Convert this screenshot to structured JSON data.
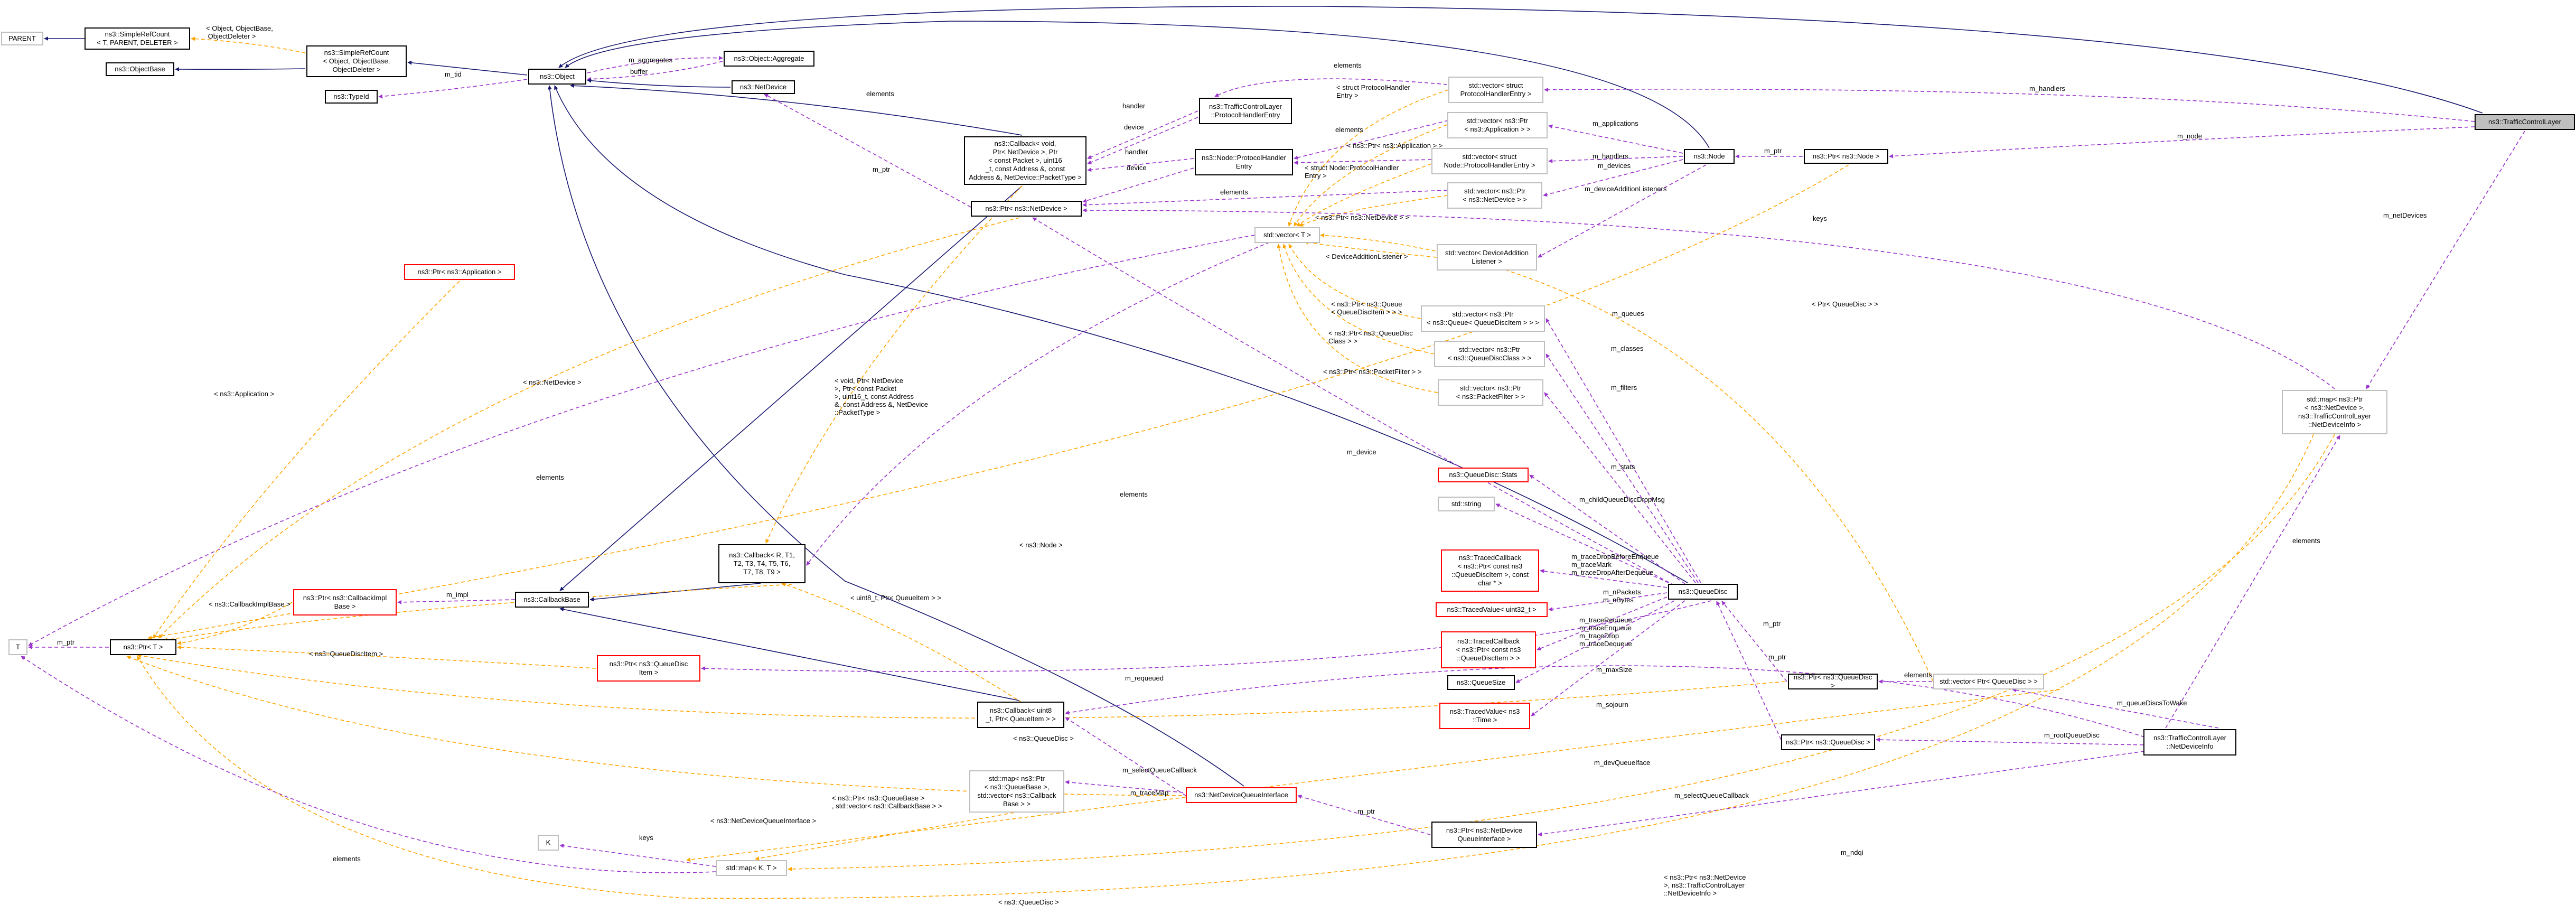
{
  "diagram": {
    "colors": {
      "inherit": "#191970",
      "usage": "#9a32cd",
      "template": "#ffa500",
      "gray_border": "#bfbfbf",
      "red_border": "#ff0000",
      "highlight": "#bfbfbf"
    },
    "nodes": {
      "parent": "PARENT",
      "simple_ref_count_t": "ns3::SimpleRefCount\n< T, PARENT, DELETER >",
      "simple_ref_count_object": "ns3::SimpleRefCount\n< Object, ObjectBase,\n ObjectDeleter >",
      "object_base": "ns3::ObjectBase",
      "object": "ns3::Object",
      "type_id": "ns3::TypeId",
      "aggregate": "ns3::Object::Aggregate",
      "net_device": "ns3::NetDevice",
      "vec_protocol_handler_entry": "std::vector< struct\n ProtocolHandlerEntry >",
      "tcl_protocol_handler_entry": "ns3::TrafficControlLayer\n::ProtocolHandlerEntry",
      "callback_void": "ns3::Callback< void,\n Ptr< NetDevice >, Ptr\n< const Packet >, uint16\n_t, const Address &, const\n Address &, NetDevice::PacketType >",
      "node_protocol_handler_entry": "ns3::Node::ProtocolHandler\nEntry",
      "vec_ptr_application": "std::vector< ns3::Ptr\n< ns3::Application > >",
      "vec_struct_node_phe": "std::vector< struct\n Node::ProtocolHandlerEntry >",
      "vec_ptr_net_device": "std::vector< ns3::Ptr\n< ns3::NetDevice > >",
      "node": "ns3::Node",
      "ptr_node": "ns3::Ptr< ns3::Node >",
      "traffic_control_layer": "ns3::TrafficControlLayer",
      "ptr_net_device": "ns3::Ptr< ns3::NetDevice >",
      "ptr_application": "ns3::Ptr< ns3::Application >",
      "vec_device_addition_listener": "std::vector< DeviceAddition\nListener >",
      "std_vector_t": "std::vector< T >",
      "vec_ptr_queue": "std::vector< ns3::Ptr\n< ns3::Queue< QueueDiscItem > > >",
      "vec_ptr_queue_disc_class": "std::vector< ns3::Ptr\n< ns3::QueueDiscClass > >",
      "vec_ptr_packet_filter": "std::vector< ns3::Ptr\n< ns3::PacketFilter > >",
      "queue_disc_stats": "ns3::QueueDisc::Stats",
      "std_string": "std::string",
      "traced_callback_item": "ns3::TracedCallback\n< ns3::Ptr< const ns3\n::QueueDiscItem >, const\n char * >",
      "traced_value_uint32": "ns3::TracedValue< uint32_t >",
      "traced_callback_const": "ns3::TracedCallback\n< ns3::Ptr< const ns3\n::QueueDiscItem > >",
      "queue_size": "ns3::QueueSize",
      "traced_value_time": "ns3::TracedValue< ns3\n::Time >",
      "callback_r_t": "ns3::Callback< R, T1,\n T2, T3, T4, T5, T6,\n T7, T8, T9 >",
      "callback_base": "ns3::CallbackBase",
      "ptr_callback_impl_base": "ns3::Ptr< ns3::CallbackImpl\nBase >",
      "ptr_t": "ns3::Ptr< T >",
      "t": "T",
      "ptr_queue_disc_item": "ns3::Ptr< ns3::QueueDisc\nItem >",
      "callback_uint8": "ns3::Callback< uint8\n_t, Ptr< QueueItem > >",
      "std_map_ptr_queue_base": "std::map< ns3::Ptr\n< ns3::QueueBase >,\n std::vector< ns3::Callback\nBase > >",
      "net_device_queue_interface": "ns3::NetDeviceQueueInterface",
      "ptr_ndqi": "ns3::Ptr< ns3::NetDevice\nQueueInterface >",
      "k": "K",
      "std_map_k_t": "std::map< K, T >",
      "queue_disc": "ns3::QueueDisc",
      "ptr_queue_disc": "ns3::Ptr< ns3::QueueDisc >",
      "vec_ptr_queue_disc": "std::vector< Ptr< QueueDisc > >",
      "ptr_queue_disc_2": "ns3::Ptr< ns3::QueueDisc >",
      "tcl_net_device_info": "ns3::TrafficControlLayer\n::NetDeviceInfo",
      "std_map_ptr_ndi": "std::map< ns3::Ptr\n< ns3::NetDevice >,\n ns3::TrafficControlLayer\n::NetDeviceInfo >"
    },
    "edge_labels": {
      "object_base_deleter": "< Object, ObjectBase,\n ObjectDeleter >",
      "m_tid": "m_tid",
      "m_aggregates": "m_aggregates",
      "buffer": "buffer",
      "elements_ptr_t": "elements",
      "elements_net_device": "elements",
      "handler_tcl": "handler",
      "device_tcl": "device",
      "handler_node": "handler",
      "device_node": "device",
      "m_ptr_net": "m_ptr",
      "elements_phe": "elements",
      "struct_protocol_handler_entry": "< struct ProtocolHandler\nEntry >",
      "ptr_application_tmpl": "< ns3::Ptr< ns3::Application > >",
      "elements_application": "elements",
      "struct_node_phe": "< struct Node::ProtocolHandler\nEntry >",
      "ptr_net_device_tmpl": "< ns3::Ptr< ns3::NetDevice > >",
      "device_addition_listener": "< DeviceAdditionListener >",
      "ptr_queue_tmpl": "< ns3::Ptr< ns3::Queue\n< QueueDiscItem > > >",
      "ptr_queue_disc_class_tmpl": "< ns3::Ptr< ns3::QueueDisc\nClass > >",
      "ptr_packet_filter_tmpl": "< ns3::Ptr< ns3::PacketFilter > >",
      "ptr_queue_disc_tmpl": "< Ptr< QueueDisc > >",
      "m_handlers": "m_handlers",
      "m_node": "m_node",
      "m_applications": "m_applications",
      "m_handlers_node": "m_handlers",
      "m_devices": "m_devices",
      "m_device_addition_listeners": "m_deviceAdditionListeners",
      "m_ptr_node": "m_ptr",
      "keys_net_device": "keys",
      "m_net_devices": "m_netDevices",
      "m_queues": "m_queues",
      "m_classes": "m_classes",
      "m_filters": "m_filters",
      "m_stats": "m_stats",
      "m_child_queue_disc_drop_msg": "m_childQueueDiscDropMsg",
      "trace_drop": "m_traceDropBeforeEnqueue\nm_traceMark\nm_traceDropAfterDequeue",
      "m_n_packets": "m_nPackets\nm_nBytes",
      "trace_enqueue": "m_traceRequeue\nm_traceEnqueue\nm_traceDrop\nm_traceDequeue",
      "m_max_size": "m_maxSize",
      "m_sojourn": "m_sojourn",
      "m_requeued": "m_requeued",
      "m_ptr_queue_disc": "m_ptr",
      "m_ptr_queue_disc_2": "m_ptr",
      "m_device": "m_device",
      "elements_callback": "elements",
      "callback_tmpl": "< void, Ptr< NetDevice\n>, Ptr< const Packet\n>, uint16_t, const Address\n&, const Address &, NetDevice\n::PacketType >",
      "m_impl": "m_impl",
      "m_ptr_t": "m_ptr",
      "callback_impl_base_tmpl": "< ns3::CallbackImplBase >",
      "queue_disc_item_tmpl": "< ns3::QueueDiscItem >",
      "application_tmpl": "< ns3::Application >",
      "net_device_tmpl": "< ns3::NetDevice >",
      "node_tmpl": "< ns3::Node >",
      "queue_disc_tmpl": "< ns3::QueueDisc >",
      "uint8_tmpl": "< uint8_t, Ptr< QueueItem > >",
      "elements_t": "elements",
      "m_select_queue_callback": "m_selectQueueCallback",
      "m_trace_map": "m_traceMap",
      "m_ptr_ndqi": "m_ptr",
      "ndqi_tmpl": "< ns3::NetDeviceQueueInterface >",
      "queue_base_tmpl": "< ns3::Ptr< ns3::QueueBase >\n, std::vector< ns3::CallbackBase > >",
      "m_dev_queue_iface": "m_devQueueIface",
      "m_select_queue_callback_2": "m_selectQueueCallback",
      "elements_queue_disc": "elements",
      "m_queue_discs_to_wake": "m_queueDiscsToWake",
      "m_root_queue_disc": "m_rootQueueDisc",
      "m_ndqi": "m_ndqi",
      "keys_k": "keys",
      "elements_k": "elements",
      "ptr_ndi_tmpl": "< ns3::Ptr< ns3::NetDevice\n>, ns3::TrafficControlLayer\n::NetDeviceInfo >",
      "queue_disc_bottom": "< ns3::QueueDisc >",
      "elements_ndi": "elements"
    }
  }
}
